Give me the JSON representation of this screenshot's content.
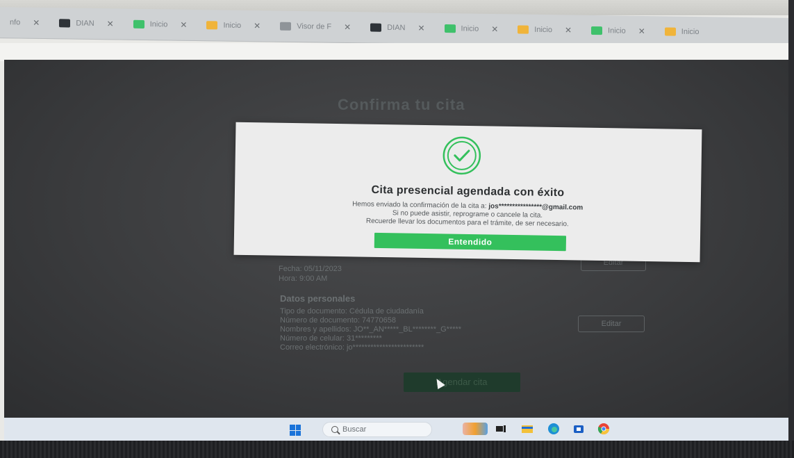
{
  "tabs": [
    {
      "label": "nfo",
      "favicon": "none"
    },
    {
      "label": "DIAN",
      "favicon": "dian"
    },
    {
      "label": "Inicio",
      "favicon": "green"
    },
    {
      "label": "Inicio",
      "favicon": "yellow"
    },
    {
      "label": "Visor de F",
      "favicon": "gray"
    },
    {
      "label": "DIAN",
      "favicon": "dian"
    },
    {
      "label": "Inicio",
      "favicon": "green"
    },
    {
      "label": "Inicio",
      "favicon": "yellow"
    },
    {
      "label": "Inicio",
      "favicon": "green"
    },
    {
      "label": "Inicio",
      "favicon": "yellow"
    }
  ],
  "modal": {
    "title": "Cita presencial agendada con éxito",
    "line1_prefix": "Hemos enviado la confirmación de la cita a: ",
    "email": "jos****************@gmail.com",
    "line2": "Si no puede asistir, reprograme o cancele la cita.",
    "line3": "Recuerde llevar los documentos para el trámite, de ser necesario.",
    "button_label": "Entendido",
    "accent": "#34c05c"
  },
  "background_page": {
    "title": "Confirma tu cita",
    "fecha": "Fecha: 05/11/2023",
    "hora": "Hora: 9:00 AM",
    "section": "Datos personales",
    "tipo_documento": "Tipo de documento: Cédula de ciudadanía",
    "numero_documento": "Número de documento: 74770658",
    "nombres": "Nombres y apellidos: JO**_AN*****_BL********_G*****",
    "celular": "Número de celular: 31*********",
    "correo": "Correo electrónico: jo************************",
    "edit_label_1": "Editar",
    "edit_label_2": "Editar",
    "confirm_label": "Agendar cita"
  },
  "taskbar": {
    "search_placeholder": "Buscar",
    "icons": [
      "start-icon",
      "search-icon",
      "widgets-icon",
      "task-view-icon",
      "file-explorer-icon",
      "edge-icon",
      "store-icon",
      "chrome-icon"
    ]
  }
}
